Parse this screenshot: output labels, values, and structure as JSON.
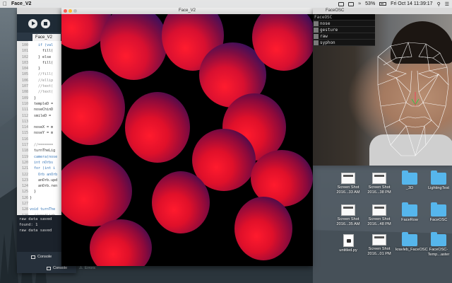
{
  "menubar": {
    "app_name": "Face_V2",
    "datetime": "Fri Oct 14  11:39:17",
    "battery": "53%"
  },
  "ide": {
    "tab_label": "Face_V2",
    "line_numbers": [
      "100",
      "101",
      "102",
      "103",
      "104",
      "105",
      "106",
      "107",
      "108",
      "109",
      "110",
      "111",
      "112",
      "113",
      "114",
      "115",
      "116",
      "117",
      "118",
      "119",
      "120",
      "121",
      "122",
      "123",
      "124",
      "125",
      "126",
      "127",
      "128",
      "129",
      "130",
      "131"
    ],
    "code_lines": [
      "    if (val",
      "      fill(",
      "    } else",
      "      fill(",
      "    }",
      "    //fill(",
      "    //ellip",
      "    //text(",
      "    //text(",
      "  }",
      "  templeD =",
      "  noseChinD",
      "  smileD =",
      "",
      "  noseX = m",
      "  noseY = m",
      "",
      "  //=======",
      "  turnTheLig",
      "  camera(nose",
      "  int nOrbs",
      "  for (int i",
      "    Orb anOrb",
      "    anOrb.upd",
      "    anOrb.ren",
      "  }",
      "}",
      "",
      "void turnThe",
      "  //spotLigh",
      "  spotLight(",
      "  spotLight("
    ],
    "console_lines": [
      "raw data saved",
      "found: 1",
      "raw data saved"
    ],
    "console_tab": "Console",
    "errors_tab": "Errors"
  },
  "sketch": {
    "title": "Face_V2"
  },
  "faceosc": {
    "title": "FaceOSC",
    "panel_items": [
      "nose",
      "gesture",
      "raw",
      "syphon"
    ]
  },
  "finder": {
    "files": [
      {
        "name": "Screen Shot 2016...33 AM",
        "kind": "screenshot"
      },
      {
        "name": "Screen Shot 2016...38 PM",
        "kind": "screenshot"
      },
      {
        "name": "_3D",
        "kind": "folder"
      },
      {
        "name": "LightingTest",
        "kind": "folder"
      },
      {
        "name": "Screen Shot 2016...35 AM",
        "kind": "screenshot"
      },
      {
        "name": "Screen Shot 2016...48 PM",
        "kind": "screenshot"
      },
      {
        "name": "FaceRow",
        "kind": "folder"
      },
      {
        "name": "FaceOSC",
        "kind": "folder"
      },
      {
        "name": "untitled.py",
        "kind": "document"
      },
      {
        "name": "Screen Shot 2016...01 PM",
        "kind": "screenshot"
      },
      {
        "name": "kravleb_FaceOSC",
        "kind": "folder"
      },
      {
        "name": "FaceOSC-Temp...aster",
        "kind": "folder"
      }
    ]
  }
}
